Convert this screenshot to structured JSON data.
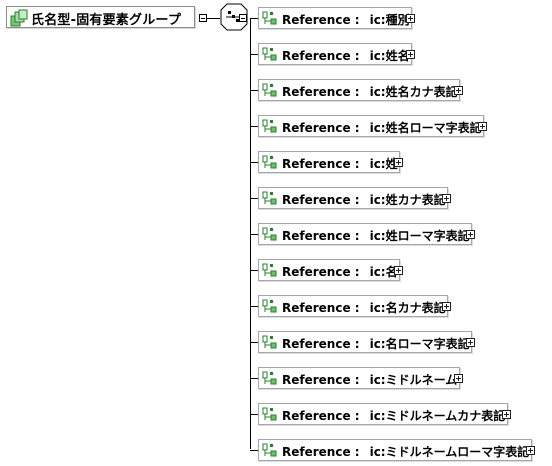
{
  "root": {
    "label": "氏名型-固有要素グループ",
    "icon": "complex-type-group-icon"
  },
  "compositor": {
    "icon": "sequence-compositor-icon"
  },
  "reference_prefix": "Reference :",
  "elements": [
    {
      "ref": "ic:種別"
    },
    {
      "ref": "ic:姓名"
    },
    {
      "ref": "ic:姓名カナ表記"
    },
    {
      "ref": "ic:姓名ローマ字表記"
    },
    {
      "ref": "ic:姓"
    },
    {
      "ref": "ic:姓カナ表記"
    },
    {
      "ref": "ic:姓ローマ字表記"
    },
    {
      "ref": "ic:名"
    },
    {
      "ref": "ic:名カナ表記"
    },
    {
      "ref": "ic:名ローマ字表記"
    },
    {
      "ref": "ic:ミドルネーム"
    },
    {
      "ref": "ic:ミドルネームカナ表記"
    },
    {
      "ref": "ic:ミドルネームローマ字表記"
    }
  ],
  "colors": {
    "border": "#a6a6a6",
    "icon_green": "#3a9a3a",
    "line": "#000000"
  }
}
